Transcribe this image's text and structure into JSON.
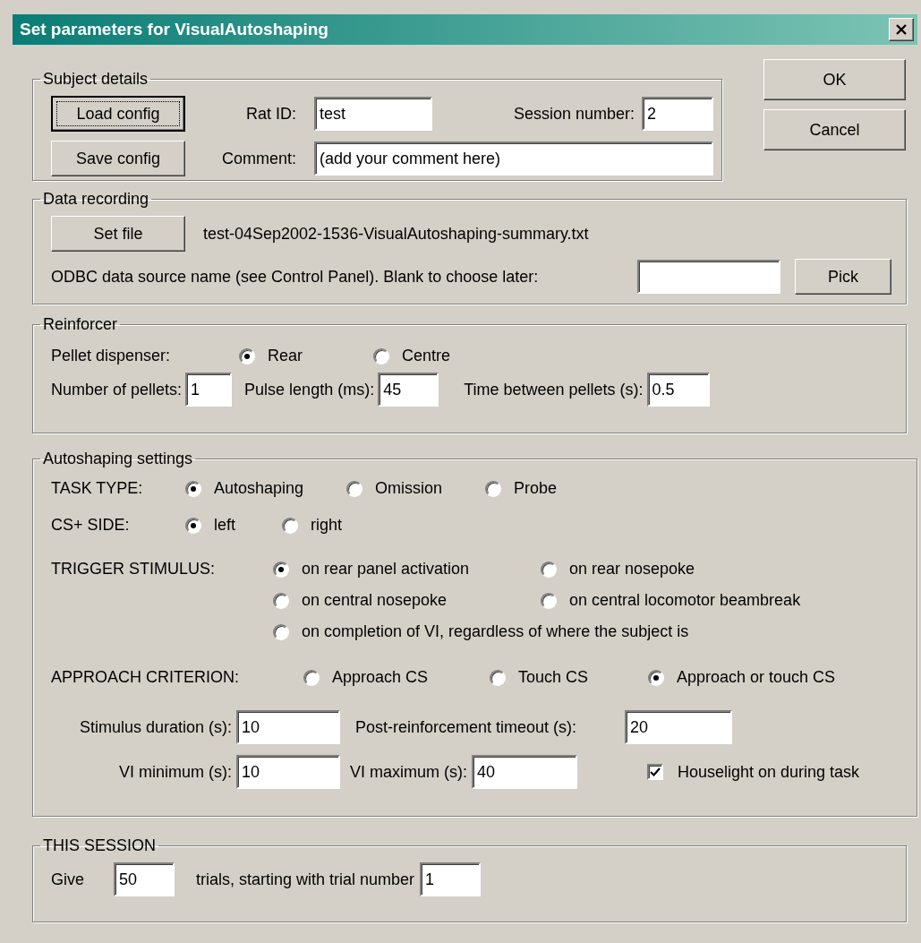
{
  "window": {
    "title": "Set parameters for VisualAutoshaping"
  },
  "subject_details": {
    "title": "Subject details",
    "buttons": [
      {
        "label": "Load config",
        "focused": true
      },
      {
        "label": "Save config",
        "focused": false
      }
    ],
    "rat_id": {
      "label": "Rat ID:",
      "value": "test"
    },
    "session_number": {
      "label": "Session number:",
      "value": "2"
    },
    "comment": {
      "label": "Comment:",
      "value": "(add your comment here)"
    }
  },
  "dialog_buttons": [
    "OK",
    "Cancel"
  ],
  "data_recording": {
    "title": "Data recording",
    "set_file_button": "Set file",
    "filename": "test-04Sep2002-1536-VisualAutoshaping-summary.txt",
    "odbc_label": "ODBC data source name (see Control Panel). Blank to choose later:",
    "pick_button": "Pick"
  },
  "reinforcer": {
    "title": "Reinforcer",
    "pellet_dispenser": {
      "label": "Pellet dispenser:",
      "options": [
        {
          "label": "Rear",
          "selected": true
        },
        {
          "label": "Centre",
          "selected": false
        }
      ]
    },
    "fields": [
      {
        "label": "Number of pellets:",
        "value": "1"
      },
      {
        "label": "Pulse length (ms):",
        "value": "45"
      },
      {
        "label": "Time between pellets (s):",
        "value": "0.5"
      }
    ]
  },
  "autoshaping": {
    "title": "Autoshaping settings",
    "task_type": {
      "label": "TASK TYPE:",
      "options": [
        {
          "label": "Autoshaping",
          "selected": true
        },
        {
          "label": "Omission",
          "selected": false
        },
        {
          "label": "Probe",
          "selected": false
        }
      ]
    },
    "cs_side": {
      "label": "CS+ SIDE:",
      "options": [
        {
          "label": "left",
          "selected": true
        },
        {
          "label": "right",
          "selected": false
        }
      ]
    },
    "trigger_stimulus": {
      "label": "TRIGGER STIMULUS:",
      "options": [
        {
          "label": "on rear panel activation",
          "selected": true
        },
        {
          "label": "on rear nosepoke",
          "selected": false
        },
        {
          "label": "on central nosepoke",
          "selected": false
        },
        {
          "label": "on central locomotor beambreak",
          "selected": false
        },
        {
          "label": "on completion of VI, regardless of where the subject is",
          "selected": false
        }
      ]
    },
    "approach_criterion": {
      "label": "APPROACH CRITERION:",
      "options": [
        {
          "label": "Approach CS",
          "selected": false
        },
        {
          "label": "Touch CS",
          "selected": false
        },
        {
          "label": "Approach or touch CS",
          "selected": true
        }
      ]
    },
    "fields": [
      {
        "label": "Stimulus duration (s):",
        "value": "10"
      },
      {
        "label": "Post-reinforcement timeout (s):",
        "value": "20"
      },
      {
        "label": "VI minimum (s):",
        "value": "10"
      },
      {
        "label": "VI maximum (s):",
        "value": "40"
      }
    ],
    "houselight": {
      "label": "Houselight on during task",
      "checked": true
    }
  },
  "this_session": {
    "title": "THIS SESSION",
    "give_label": "Give",
    "trials": "50",
    "middle_label": "trials, starting with trial number",
    "start_trial": "1"
  }
}
